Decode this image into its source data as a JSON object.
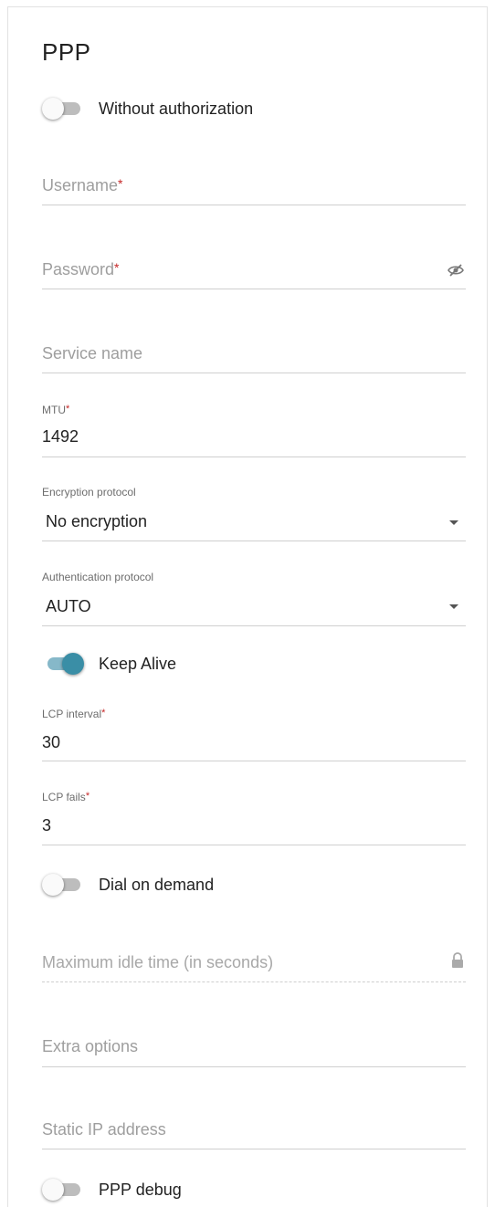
{
  "section": {
    "title": "PPP"
  },
  "without_auth": {
    "label": "Without authorization",
    "enabled": false
  },
  "username": {
    "placeholder": "Username",
    "required_mark": "*"
  },
  "password": {
    "placeholder": "Password",
    "required_mark": "*",
    "toggle_icon": "eye-slash-icon"
  },
  "service_name": {
    "placeholder": "Service name"
  },
  "mtu": {
    "label": "MTU",
    "required_mark": "*",
    "value": "1492"
  },
  "encryption": {
    "label": "Encryption protocol",
    "value": "No encryption"
  },
  "authentication": {
    "label": "Authentication protocol",
    "value": "AUTO"
  },
  "keep_alive": {
    "label": "Keep Alive",
    "enabled": true
  },
  "lcp_interval": {
    "label": "LCP interval",
    "required_mark": "*",
    "value": "30"
  },
  "lcp_fails": {
    "label": "LCP fails",
    "required_mark": "*",
    "value": "3"
  },
  "dial_on_demand": {
    "label": "Dial on demand",
    "enabled": false
  },
  "max_idle": {
    "placeholder": "Maximum idle time (in seconds)",
    "lock_icon": "lock-icon"
  },
  "extra_options": {
    "placeholder": "Extra options"
  },
  "static_ip": {
    "placeholder": "Static IP address"
  },
  "ppp_debug": {
    "label": "PPP debug",
    "enabled": false
  },
  "colors": {
    "accent": "#3a8ea6",
    "accent_track": "#86b8c9",
    "required": "#c62828"
  }
}
